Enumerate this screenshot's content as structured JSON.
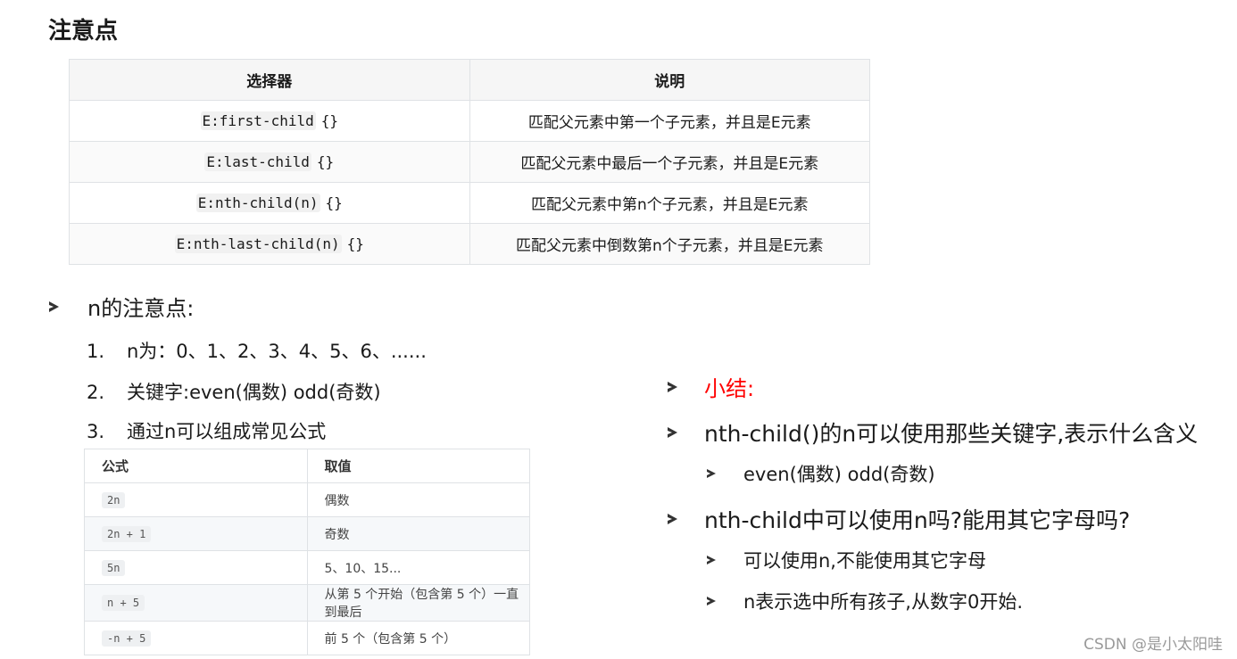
{
  "title": "注意点",
  "selector_table": {
    "headers": [
      "选择器",
      "说明"
    ],
    "rows": [
      {
        "code": "E:first-child",
        "braces": "{}",
        "desc": "匹配父元素中第一个子元素，并且是E元素"
      },
      {
        "code": "E:last-child",
        "braces": "{}",
        "desc": "匹配父元素中最后一个子元素，并且是E元素"
      },
      {
        "code": "E:nth-child(n)",
        "braces": "{}",
        "desc": "匹配父元素中第n个子元素，并且是E元素"
      },
      {
        "code": "E:nth-last-child(n)",
        "braces": "{}",
        "desc": "匹配父元素中倒数第n个子元素，并且是E元素"
      }
    ]
  },
  "n_notes": {
    "heading": "n的注意点:",
    "items": [
      {
        "num": "1.",
        "text": "n为：0、1、2、3、4、5、6、......"
      },
      {
        "num": "2.",
        "text": "关键字:even(偶数) odd(奇数)"
      },
      {
        "num": "3.",
        "text": "通过n可以组成常见公式"
      }
    ]
  },
  "formula_table": {
    "headers": [
      "公式",
      "取值"
    ],
    "rows": [
      {
        "formula": "2n",
        "value": "偶数"
      },
      {
        "formula": "2n + 1",
        "value": "奇数"
      },
      {
        "formula": "5n",
        "value": "5、10、15..."
      },
      {
        "formula": "n + 5",
        "value": "从第 5 个开始（包含第 5 个）一直到最后"
      },
      {
        "formula": "-n + 5",
        "value": "前 5 个（包含第 5 个）"
      }
    ]
  },
  "summary": {
    "heading": "小结:",
    "heading_color": "#ff0000",
    "q1": "nth-child()的n可以使用那些关键字,表示什么含义",
    "a1": "even(偶数) odd(奇数)",
    "q2": "nth-child中可以使用n吗?能用其它字母吗?",
    "a2a": "可以使用n,不能使用其它字母",
    "a2b": "n表示选中所有孩子,从数字0开始."
  },
  "watermark": "CSDN @是小太阳哇"
}
